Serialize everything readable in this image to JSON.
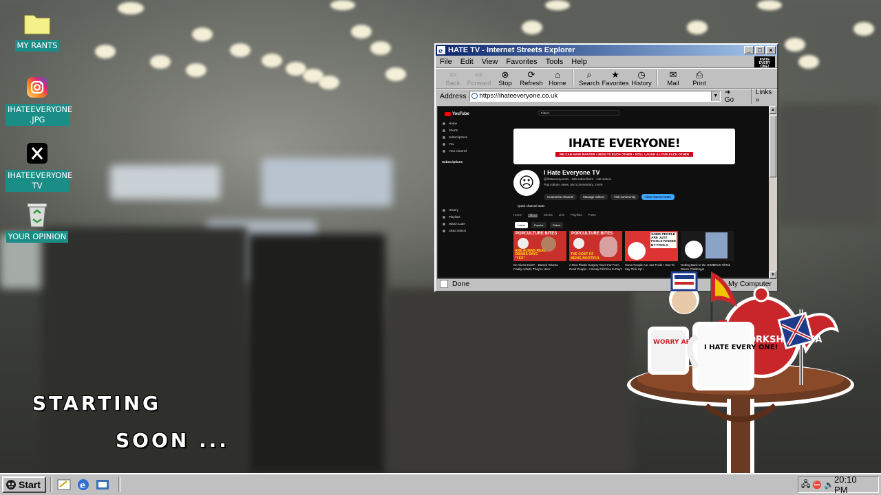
{
  "desktop": {
    "icons": [
      {
        "label": "MY RANTS",
        "icon": "folder-icon"
      },
      {
        "label": "IHATEEVERYONE .JPG",
        "icon": "instagram-icon"
      },
      {
        "label": "IHATEEVERYONE TV",
        "icon": "x-icon"
      },
      {
        "label": "YOUR OPINION",
        "icon": "recycle-bin-icon"
      }
    ],
    "starting": "STARTING",
    "soon": "SOON ..."
  },
  "window": {
    "title": "HATE TV - Internet Streets Explorer",
    "menu": [
      "File",
      "Edit",
      "View",
      "Favorites",
      "Tools",
      "Help"
    ],
    "toolbar": [
      {
        "label": "Back",
        "icon": "back-arrow-icon",
        "disabled": true
      },
      {
        "label": "Forward",
        "icon": "forward-arrow-icon",
        "disabled": true
      },
      {
        "label": "Stop",
        "icon": "stop-icon"
      },
      {
        "label": "Refresh",
        "icon": "refresh-icon"
      },
      {
        "label": "Home",
        "icon": "home-icon"
      },
      {
        "label": "Search",
        "icon": "search-icon"
      },
      {
        "label": "Favorites",
        "icon": "favorites-folder-icon"
      },
      {
        "label": "History",
        "icon": "history-icon"
      },
      {
        "label": "Mail",
        "icon": "mail-icon"
      },
      {
        "label": "Print",
        "icon": "print-icon"
      }
    ],
    "address_label": "Address",
    "address_value": "https://ihateeveryone.co.uk",
    "go_label": "Go",
    "links_label": "Links",
    "status": "Done",
    "status_zone": "My Computer"
  },
  "page": {
    "logo": "YouTube",
    "search_placeholder": "Filters",
    "sidebar": [
      "Home",
      "Shorts",
      "Subscriptions",
      "You",
      "Your channel",
      "History",
      "Playlists",
      "Watch Later",
      "Liked videos"
    ],
    "subs_header": "Subscriptions",
    "banner_title": "IHATE EVERYONE!",
    "banner_sub": "WE CAN HAVE BANTER • INSULTS EACH OTHER • STILL LAUGH & LOVE EACH OTHER",
    "channel_name": "I Hate Everyone TV",
    "channel_meta": "@ihateeveryonetv · 169 subscribers · 146 videos",
    "channel_desc": "Pop culture, news, and commentary...more",
    "buttons": [
      "Customise channel",
      "Manage videos",
      "Visit community",
      "View channel stats"
    ],
    "quick_stats": "Quick channel stats",
    "tabs": [
      "Home",
      "Videos",
      "Shorts",
      "Live",
      "Playlists",
      "Posts"
    ],
    "chips": [
      "Latest",
      "Popular",
      "Oldest"
    ],
    "videos": [
      {
        "title": "Do Aliens Exist?... Barack Obama Finally Admits 'They're Here'",
        "caption": "ARE ALIENS REAL OBAMA SAYS \"YES\"",
        "kicker": "POPCULTURE BITES"
      },
      {
        "title": "A New Plastic Surgery Goes Far From Dead People - A Booty Fill Price to Pay?",
        "caption": "THE COST OF BEING BOOTIFUL",
        "kicker": "POPCULTURE BITES"
      },
      {
        "title": "Some People Are Just Fools ! How To Say 'Pick Up' !",
        "caption": "SOME PEOPLE ARE JUST FOOLS RAISED BY FOOLS",
        "kicker": ""
      },
      {
        "title": "Getting Back to the JUMBRUS TikTok Dance Challenge!",
        "caption": "",
        "kicker": ""
      }
    ]
  },
  "taskbar": {
    "start_label": "Start",
    "clock": "20:10 PM"
  },
  "mascot": {
    "mug1_text": "I HATE EVERY ONE!",
    "mug2_text": "WORRY ABOUT PANICS",
    "teapot_text": "YORKSHIRE TEA"
  },
  "colors": {
    "titlebar": "#0a246a",
    "desktop_label_bg": "#1a8e86",
    "yt_red": "#ff0000"
  }
}
